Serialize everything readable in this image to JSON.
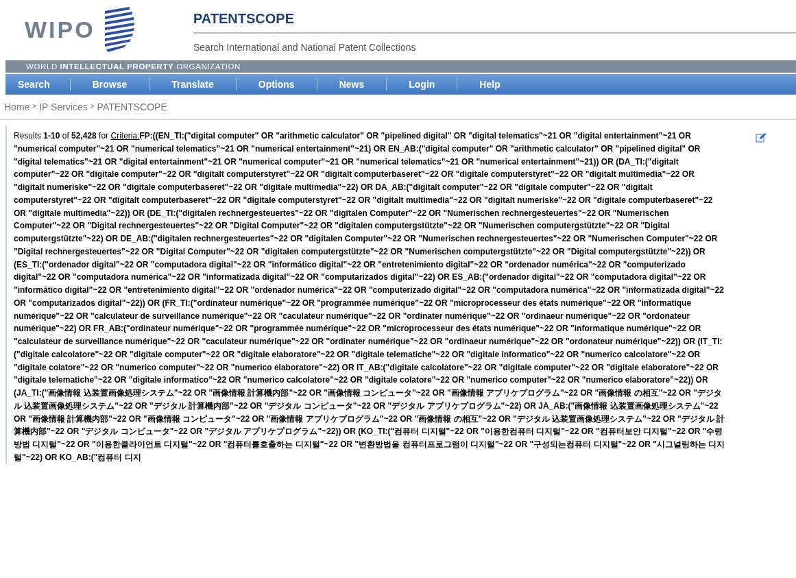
{
  "header": {
    "logo_text": "WIPO",
    "title": "PATENTSCOPE",
    "subtitle": "Search International and National Patent Collections",
    "organization_band": {
      "light_1": "WORLD",
      "bold": "INTELLECTUAL PROPERTY",
      "light_2": "ORGANIZATION"
    }
  },
  "nav": [
    {
      "label": "Search"
    },
    {
      "label": "Browse"
    },
    {
      "label": "Translate"
    },
    {
      "label": "Options"
    },
    {
      "label": "News"
    },
    {
      "label": "Login"
    },
    {
      "label": "Help"
    }
  ],
  "breadcrumb": {
    "items": [
      "Home",
      "IP Services",
      "PATENTSCOPE"
    ],
    "separator": ">"
  },
  "results": {
    "summary": "Results **1-10** of **52,428** for",
    "criteria_link": "Criteria:",
    "query": "FP:((EN_TI:(\"digital computer\" OR \"arithmetic calculator\" OR \"pipelined digital\" OR \"digital telematics\"~21 OR \"digital entertainment\"~21 OR \"numerical computer\"~21 OR \"numerical telematics\"~21 OR \"numerical entertainment\"~21) OR EN_AB:(\"digital computer\" OR \"arithmetic calculator\" OR \"pipelined digital\" OR \"digital telematics\"~21 OR \"digital entertainment\"~21 OR \"numerical computer\"~21 OR \"numerical telematics\"~21 OR \"numerical entertainment\"~21)) OR (DA_TI:(\"digitalt computer\"~22 OR \"digitale computer\"~22 OR \"digitalt computerstyret\"~22 OR \"digitalt computerbaseret\"~22 OR \"digitale computerstyret\"~22 OR \"digitalt multimedia\"~22 OR \"digitalt numeriske\"~22 OR \"digitale computerbaseret\"~22 OR \"digitale multimedia\"~22) OR DA_AB:(\"digitalt computer\"~22 OR \"digitale computer\"~22 OR \"digitalt computerstyret\"~22 OR \"digitalt computerbaseret\"~22 OR \"digitale computerstyret\"~22 OR \"digitalt multimedia\"~22 OR \"digitalt numeriske\"~22 OR \"digitale computerbaseret\"~22 OR \"digitale multimedia\"~22)) OR (DE_TI:(\"digitalen rechnergesteuertes\"~22 OR \"digitalen Computer\"~22 OR \"Numerischen rechnergesteuertes\"~22 OR \"Numerischen Computer\"~22 OR \"Digital rechnergesteuertes\"~22 OR \"Digital Computer\"~22 OR \"digitalen computergstützte\"~22 OR \"Numerischen computergstützte\"~22 OR \"Digital computergstützte\"~22) OR DE_AB:(\"digitalen rechnergesteuertes\"~22 OR \"digitalen Computer\"~22 OR \"Numerischen rechnergesteuertes\"~22 OR \"Numerischen Computer\"~22 OR \"Digital rechnergesteuertes\"~22 OR \"Digital Computer\"~22 OR \"digitalen computergstützte\"~22 OR \"Numerischen computergstützte\"~22 OR \"Digital computergstützte\"~22)) OR (ES_TI:(\"ordenador digital\"~22 OR \"computadora digital\"~22 OR \"informático digital\"~22 OR \"entretenimiento digital\"~22 OR \"ordenador numérica\"~22 OR \"computerizado digital\"~22 OR \"computadora numérica\"~22 OR \"informatizada digital\"~22 OR \"computarizados digital\"~22) OR ES_AB:(\"ordenador digital\"~22 OR \"computadora digital\"~22 OR \"informático digital\"~22 OR \"entretenimiento digital\"~22 OR \"ordenador numérica\"~22 OR \"computerizado digital\"~22 OR \"computadora numérica\"~22 OR \"informatizada digital\"~22 OR \"computarizados digital\"~22)) OR (FR_TI:(\"ordinateur numérique\"~22 OR \"programmée numérique\"~22 OR \"microprocesseur des états numérique\"~22 OR \"informatique numérique\"~22 OR \"calculateur de surveillance numérique\"~22 OR \"caculateur numérique\"~22 OR \"ordinater numérique\"~22 OR \"ordinaeur numérique\"~22 OR \"ordonateur numérique\"~22) OR FR_AB:(\"ordinateur numérique\"~22 OR \"programmée numérique\"~22 OR \"microprocesseur des états numérique\"~22 OR \"informatique numérique\"~22 OR \"calculateur de surveillance numérique\"~22 OR \"caculateur numérique\"~22 OR \"ordinater numérique\"~22 OR \"ordinaeur numérique\"~22 OR \"ordonateur numérique\"~22)) OR (IT_TI:(\"digitale calcolatore\"~22 OR \"digitale computer\"~22 OR \"digitale elaboratore\"~22 OR \"digitale telematiche\"~22 OR \"digitale informatico\"~22 OR \"numerico calcolatore\"~22 OR \"digitale colatore\"~22 OR \"numerico computer\"~22 OR \"numerico elaboratore\"~22) OR IT_AB:(\"digitale calcolatore\"~22 OR \"digitale computer\"~22 OR \"digitale elaboratore\"~22 OR \"digitale telematiche\"~22 OR \"digitale informatico\"~22 OR \"numerico calcolatore\"~22 OR \"digitale colatore\"~22 OR \"numerico computer\"~22 OR \"numerico elaboratore\"~22)) OR (JA_TI:(\"画像情報 込装置画像処理システム\"~22 OR \"画像情報 計算機内部\"~22 OR \"画像情報 コンピュータ\"~22 OR \"画像情報 アプリケプログラム\"~22 OR \"画像情報 の相互\"~22 OR \"デジタル 込装置画像処理システム\"~22 OR \"デジタル 計算機内部\"~22 OR \"デジタル コンピュータ\"~22 OR \"デジタル アプリケプログラム\"~22) OR JA_AB:(\"画像情報 込装置画像処理システム\"~22 OR \"画像情報 計算機内部\"~22 OR \"画像情報 コンピュータ\"~22 OR \"画像情報 アプリケプログラム\"~22 OR \"画像情報 の相互\"~22 OR \"デジタル 込装置画像処理システム\"~22 OR \"デジタル 計算機内部\"~22 OR \"デジタル コンピュータ\"~22 OR \"デジタル アプリケプログラム\"~22)) OR (KO_TI:(\"컴퓨터 디지털\"~22 OR \"이용한컴퓨터 디지털\"~22 OR \"컴퓨터보안 디지털\"~22 OR \"수령방법 디지털\"~22 OR \"이용한클라이언트 디지털\"~22 OR \"컴퓨터를호출하는 디지털\"~22 OR \"변환방법을 컴퓨터프로그램이 디지털\"~22 OR \"구성되는컴퓨터 디지털\"~22 OR \"시그널링하는 디지털\"~22) OR KO_AB:(\"컴퓨터 디지"
  }
}
